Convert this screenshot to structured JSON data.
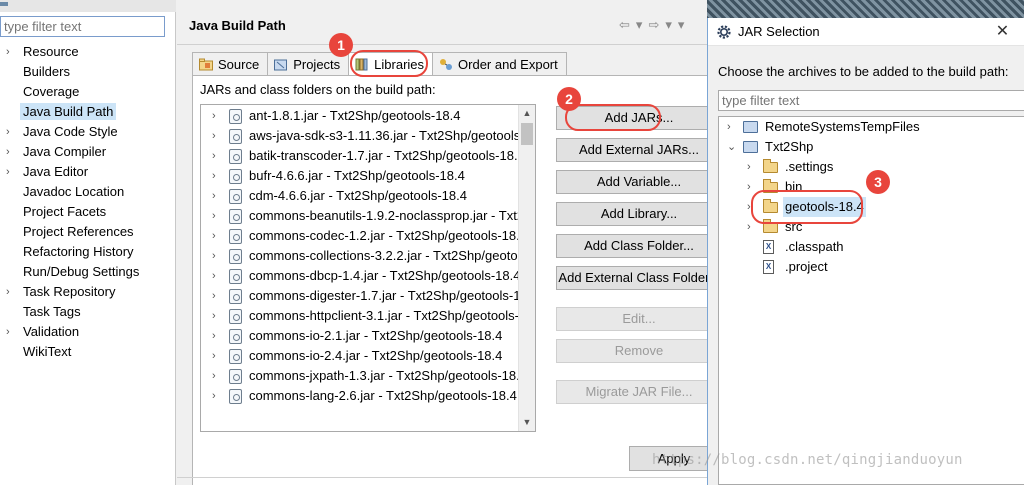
{
  "left_pane": {
    "filter_placeholder": "type filter text",
    "items": [
      {
        "label": "Resource",
        "expandable": true
      },
      {
        "label": "Builders",
        "expandable": false
      },
      {
        "label": "Coverage",
        "expandable": false
      },
      {
        "label": "Java Build Path",
        "expandable": false,
        "selected": true
      },
      {
        "label": "Java Code Style",
        "expandable": true
      },
      {
        "label": "Java Compiler",
        "expandable": true
      },
      {
        "label": "Java Editor",
        "expandable": true
      },
      {
        "label": "Javadoc Location",
        "expandable": false
      },
      {
        "label": "Project Facets",
        "expandable": false
      },
      {
        "label": "Project References",
        "expandable": false
      },
      {
        "label": "Refactoring History",
        "expandable": false
      },
      {
        "label": "Run/Debug Settings",
        "expandable": false
      },
      {
        "label": "Task Repository",
        "expandable": true
      },
      {
        "label": "Task Tags",
        "expandable": false
      },
      {
        "label": "Validation",
        "expandable": true
      },
      {
        "label": "WikiText",
        "expandable": false
      }
    ]
  },
  "main": {
    "title": "Java Build Path",
    "nav": {
      "back": "⇦",
      "back_menu": "▾",
      "forward": "⇨",
      "forward_menu": "▾",
      "view_menu": "▾"
    },
    "tabs": [
      {
        "label": "Source",
        "active": false
      },
      {
        "label": "Projects",
        "active": false
      },
      {
        "label": "Libraries",
        "active": true
      },
      {
        "label": "Order and Export",
        "active": false
      }
    ],
    "libraries_label": "JARs and class folders on the build path:",
    "jars": [
      "ant-1.8.1.jar - Txt2Shp/geotools-18.4",
      "aws-java-sdk-s3-1.11.36.jar - Txt2Shp/geotools",
      "batik-transcoder-1.7.jar - Txt2Shp/geotools-18.",
      "bufr-4.6.6.jar - Txt2Shp/geotools-18.4",
      "cdm-4.6.6.jar - Txt2Shp/geotools-18.4",
      "commons-beanutils-1.9.2-noclassprop.jar - Txt2",
      "commons-codec-1.2.jar - Txt2Shp/geotools-18.",
      "commons-collections-3.2.2.jar - Txt2Shp/geotoo",
      "commons-dbcp-1.4.jar - Txt2Shp/geotools-18.4",
      "commons-digester-1.7.jar - Txt2Shp/geotools-1",
      "commons-httpclient-3.1.jar - Txt2Shp/geotools-",
      "commons-io-2.1.jar - Txt2Shp/geotools-18.4",
      "commons-io-2.4.jar - Txt2Shp/geotools-18.4",
      "commons-jxpath-1.3.jar - Txt2Shp/geotools-18.",
      "commons-lang-2.6.jar - Txt2Shp/geotools-18.4"
    ],
    "buttons": {
      "add_jars": "Add JARs...",
      "add_external_jars": "Add External JARs...",
      "add_variable": "Add Variable...",
      "add_library": "Add Library...",
      "add_class_folder": "Add Class Folder...",
      "add_external_class_folder": "Add External Class Folder...",
      "edit": "Edit...",
      "remove": "Remove",
      "migrate_jar": "Migrate JAR File...",
      "apply": "Apply"
    }
  },
  "dialog": {
    "title": "JAR Selection",
    "close": "✕",
    "prompt": "Choose the archives to be added to the build path:",
    "filter_placeholder": "type filter text",
    "tree": [
      {
        "label": "RemoteSystemsTempFiles",
        "level": 0,
        "icon": "project-icon",
        "arrow": "›"
      },
      {
        "label": "Txt2Shp",
        "level": 0,
        "icon": "project-icon",
        "arrow": "⌄"
      },
      {
        "label": ".settings",
        "level": 1,
        "icon": "folder-icon",
        "arrow": "›"
      },
      {
        "label": "bin",
        "level": 1,
        "icon": "folder-icon",
        "arrow": "›"
      },
      {
        "label": "geotools-18.4",
        "level": 1,
        "icon": "folder-icon",
        "arrow": "›",
        "selected": true
      },
      {
        "label": "src",
        "level": 1,
        "icon": "folder-icon",
        "arrow": "›"
      },
      {
        "label": ".classpath",
        "level": 1,
        "icon": "file-icon",
        "arrow": ""
      },
      {
        "label": ".project",
        "level": 1,
        "icon": "file-icon",
        "arrow": ""
      }
    ]
  },
  "callouts": {
    "step1": "1",
    "step2": "2",
    "step3": "3",
    "color": "#e8453c"
  },
  "watermark": "https://blog.csdn.net/qingjianduoyun"
}
